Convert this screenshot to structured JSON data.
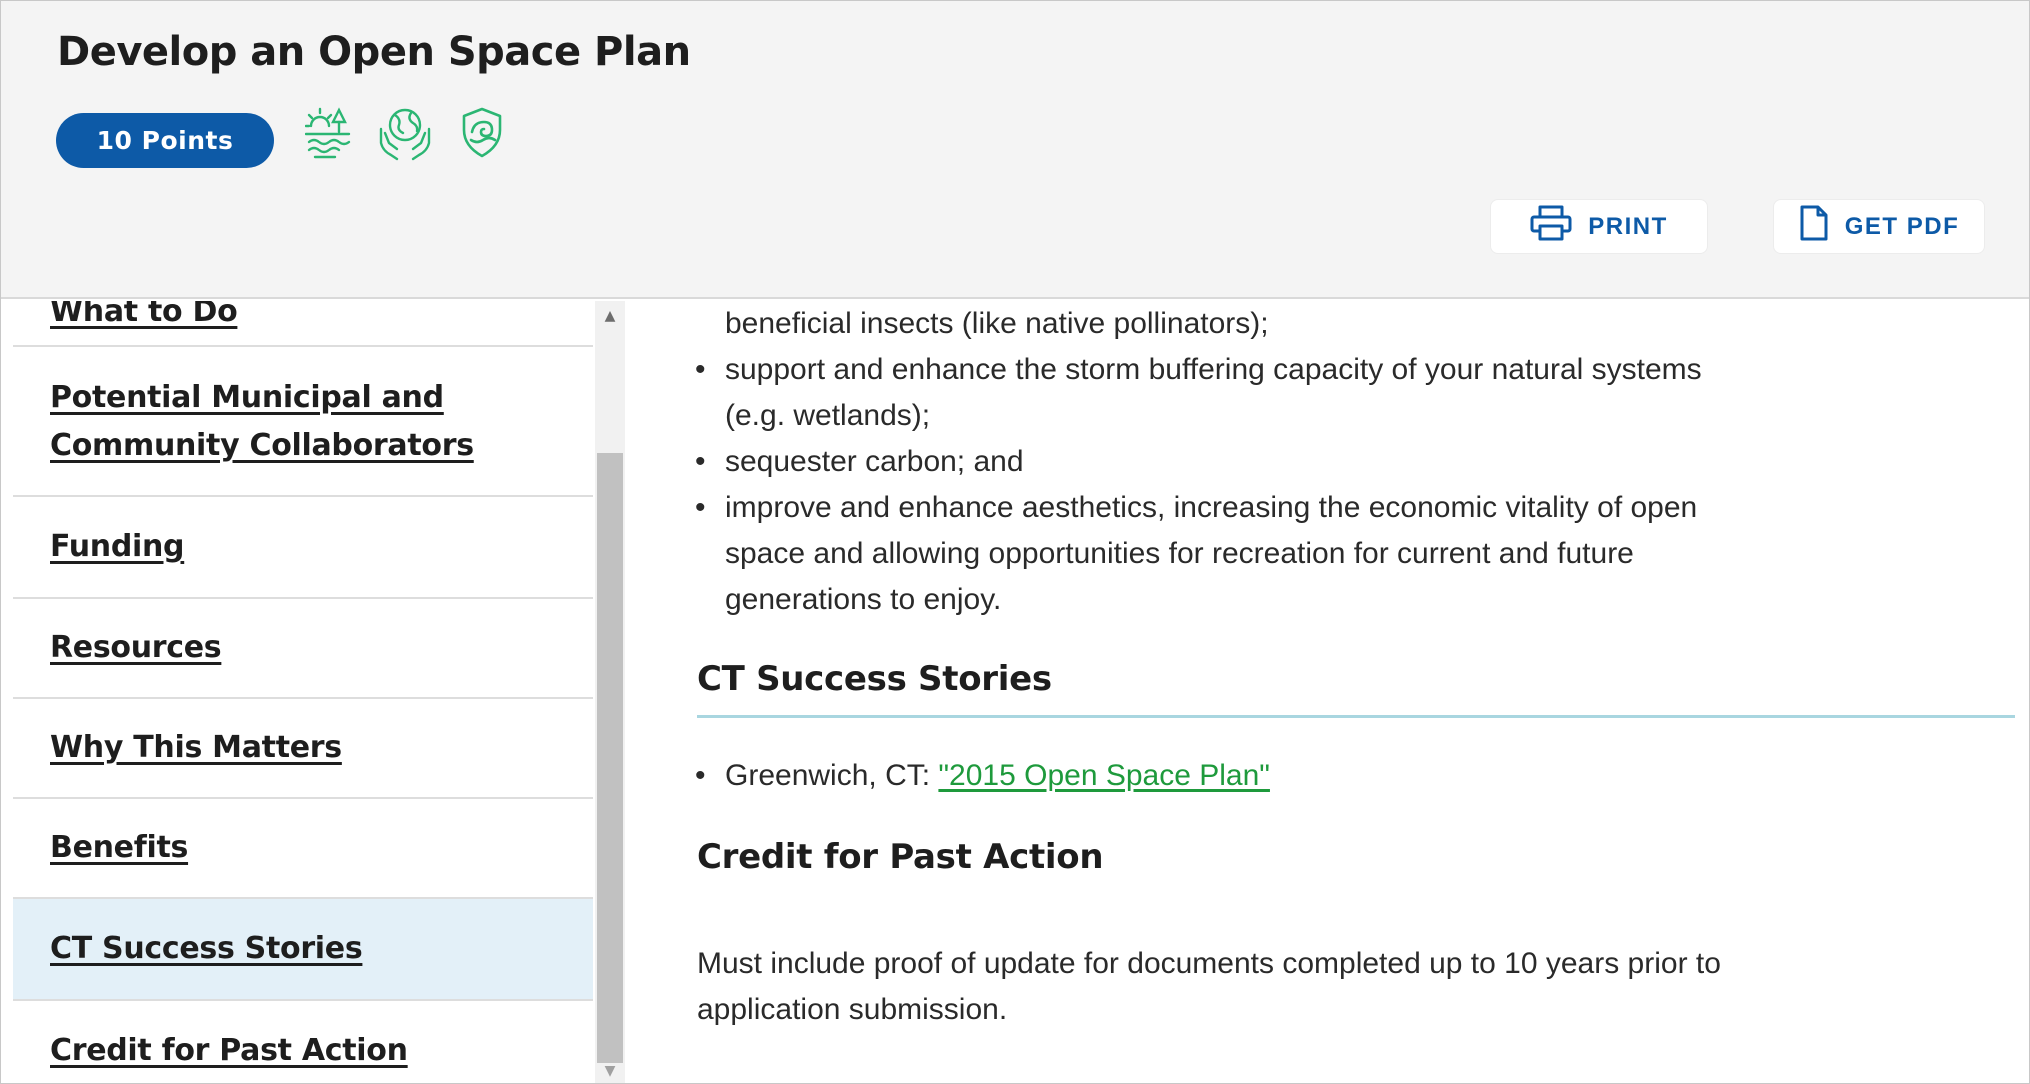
{
  "header": {
    "title": "Develop an Open Space Plan",
    "points_badge": "10 Points",
    "category_icons": [
      "climate-adaptation-icon",
      "global-stewardship-icon",
      "resilience-shield-icon"
    ],
    "print_label": "PRINT",
    "pdf_label": "GET PDF"
  },
  "sidebar": {
    "items": [
      {
        "label": "What to Do",
        "active": false
      },
      {
        "label": "Potential Municipal and Community Collaborators",
        "active": false
      },
      {
        "label": "Funding",
        "active": false
      },
      {
        "label": "Resources",
        "active": false
      },
      {
        "label": "Why This Matters",
        "active": false
      },
      {
        "label": "Benefits",
        "active": false
      },
      {
        "label": "CT Success Stories",
        "active": true
      },
      {
        "label": "Credit for Past Action",
        "active": false
      }
    ]
  },
  "content": {
    "bullets": [
      {
        "lines": [
          "beneficial insects (like native pollinators);"
        ],
        "continued": true
      },
      {
        "lines": [
          "support and enhance the storm buffering capacity of your natural systems",
          "(e.g. wetlands);"
        ]
      },
      {
        "lines": [
          "sequester carbon; and"
        ]
      },
      {
        "lines": [
          "improve and enhance aesthetics, increasing the economic vitality of open",
          "space and allowing opportunities for recreation for current and future",
          "generations to enjoy."
        ]
      }
    ],
    "success_stories": {
      "heading": "CT Success Stories",
      "items": [
        {
          "prefix": "Greenwich, CT: ",
          "link_text": "\"2015 Open Space Plan\""
        }
      ]
    },
    "credit": {
      "heading": "Credit for Past Action",
      "text_lines": [
        "Must include proof of update for documents completed up to 10 years prior to",
        "application submission."
      ]
    }
  },
  "colors": {
    "brand_blue": "#0d5aa7",
    "icon_green": "#2bb673",
    "link_green": "#1e9a3c",
    "active_bg": "#e3f0f8",
    "rule_color": "#a9d6e0"
  }
}
